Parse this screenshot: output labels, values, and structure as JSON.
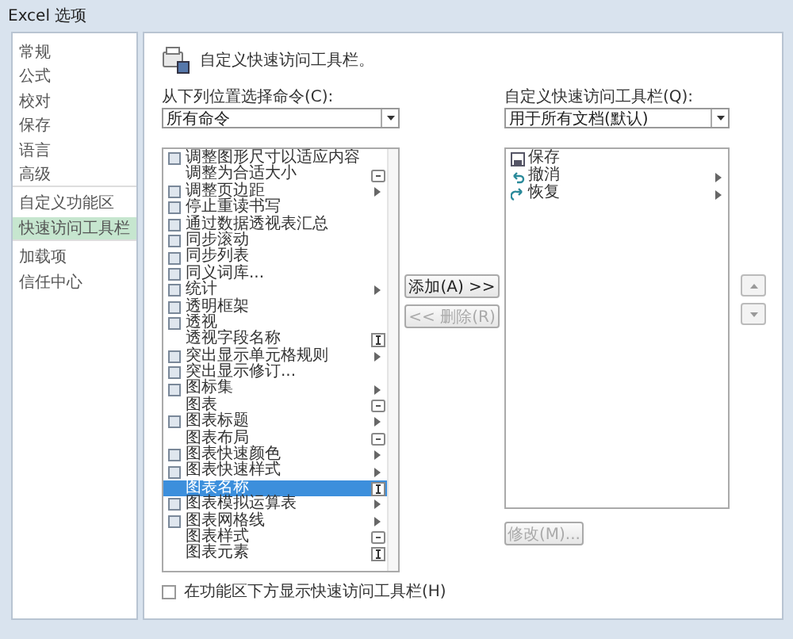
{
  "window": {
    "title": "Excel 选项"
  },
  "sidebar": {
    "items": [
      {
        "label": "常规",
        "selected": false
      },
      {
        "label": "公式",
        "selected": false
      },
      {
        "label": "校对",
        "selected": false
      },
      {
        "label": "保存",
        "selected": false
      },
      {
        "label": "语言",
        "selected": false
      },
      {
        "label": "高级",
        "selected": false,
        "divider_after": true
      },
      {
        "label": "自定义功能区",
        "selected": false
      },
      {
        "label": "快速访问工具栏",
        "selected": true,
        "divider_after": true
      },
      {
        "label": "加载项",
        "selected": false
      },
      {
        "label": "信任中心",
        "selected": false
      }
    ]
  },
  "header": {
    "title": "自定义快速访问工具栏。"
  },
  "choose_from": {
    "label": "从下列位置选择命令(C):",
    "value": "所有命令"
  },
  "commands": [
    {
      "label": "调整图形尺寸以适应内容",
      "icon": true,
      "kind": "none",
      "selected": false
    },
    {
      "label": "调整为合适大小",
      "icon": false,
      "kind": "dropdown",
      "selected": false
    },
    {
      "label": "调整页边距",
      "icon": true,
      "kind": "submenu",
      "selected": false
    },
    {
      "label": "停止重读书写",
      "icon": true,
      "kind": "none",
      "selected": false
    },
    {
      "label": "通过数据透视表汇总",
      "icon": true,
      "kind": "none",
      "selected": false
    },
    {
      "label": "同步滚动",
      "icon": true,
      "kind": "none",
      "selected": false
    },
    {
      "label": "同步列表",
      "icon": true,
      "kind": "none",
      "selected": false
    },
    {
      "label": "同义词库...",
      "icon": true,
      "kind": "none",
      "selected": false
    },
    {
      "label": "统计",
      "icon": true,
      "kind": "submenu",
      "selected": false
    },
    {
      "label": "透明框架",
      "icon": true,
      "kind": "none",
      "selected": false
    },
    {
      "label": "透视",
      "icon": true,
      "kind": "none",
      "selected": false
    },
    {
      "label": "透视字段名称",
      "icon": false,
      "kind": "textbox",
      "selected": false
    },
    {
      "label": "突出显示单元格规则",
      "icon": true,
      "kind": "submenu",
      "selected": false
    },
    {
      "label": "突出显示修订...",
      "icon": true,
      "kind": "none",
      "selected": false
    },
    {
      "label": "图标集",
      "icon": true,
      "kind": "submenu",
      "selected": false
    },
    {
      "label": "图表",
      "icon": false,
      "kind": "dropdown",
      "selected": false
    },
    {
      "label": "图表标题",
      "icon": true,
      "kind": "submenu",
      "selected": false
    },
    {
      "label": "图表布局",
      "icon": false,
      "kind": "dropdown",
      "selected": false
    },
    {
      "label": "图表快速颜色",
      "icon": true,
      "kind": "submenu",
      "selected": false
    },
    {
      "label": "图表快速样式",
      "icon": true,
      "kind": "submenu",
      "selected": false
    },
    {
      "label": "图表名称",
      "icon": false,
      "kind": "textbox",
      "selected": true
    },
    {
      "label": "图表模拟运算表",
      "icon": true,
      "kind": "submenu",
      "selected": false
    },
    {
      "label": "图表网格线",
      "icon": true,
      "kind": "submenu",
      "selected": false
    },
    {
      "label": "图表样式",
      "icon": false,
      "kind": "dropdown",
      "selected": false
    },
    {
      "label": "图表元素",
      "icon": false,
      "kind": "textbox",
      "selected": false
    }
  ],
  "show_below": {
    "label": "在功能区下方显示快速访问工具栏(H)",
    "checked": false
  },
  "add_button": {
    "label": "添加(A) >>",
    "disabled": false
  },
  "remove_button": {
    "label": "<< 删除(R)",
    "disabled": true
  },
  "customize_for": {
    "label": "自定义快速访问工具栏(Q):",
    "value": "用于所有文档(默认)"
  },
  "toolbar_items": [
    {
      "label": "保存",
      "kind": "save",
      "submenu": false
    },
    {
      "label": "撤消",
      "kind": "undo",
      "submenu": true
    },
    {
      "label": "恢复",
      "kind": "redo",
      "submenu": true
    }
  ],
  "modify_button": {
    "label": "修改(M)...",
    "disabled": true
  }
}
